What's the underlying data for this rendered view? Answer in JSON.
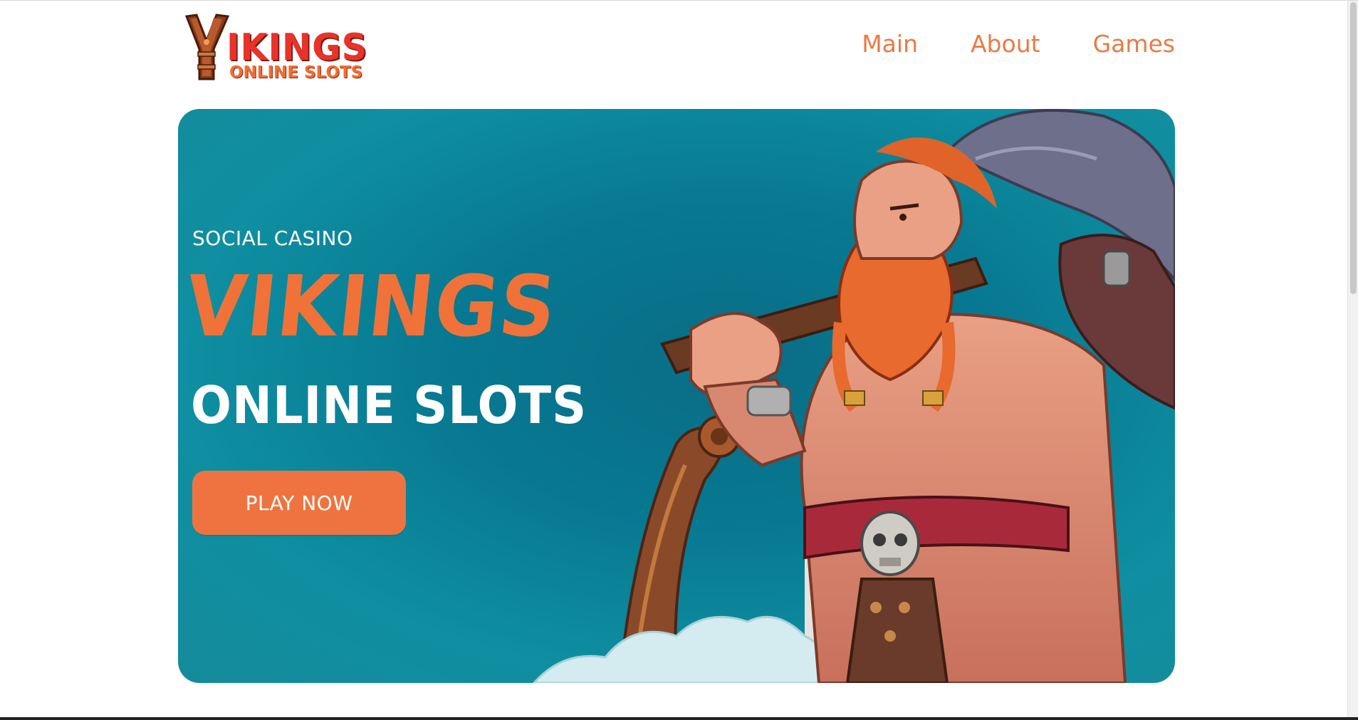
{
  "header": {
    "logo": {
      "word": "IKINGS",
      "sub": "ONLINE SLOTS"
    },
    "nav": [
      {
        "label": "Main"
      },
      {
        "label": "About"
      },
      {
        "label": "Games"
      }
    ]
  },
  "hero": {
    "kicker": "SOCIAL CASINO",
    "title": "VIKINGS",
    "subtitle": "ONLINE SLOTS",
    "cta_label": "PLAY NOW"
  },
  "colors": {
    "accent": "#ef7340",
    "nav_text": "#e97a45",
    "logo_red": "#e8332a",
    "hero_teal": "#0b7a8f"
  }
}
